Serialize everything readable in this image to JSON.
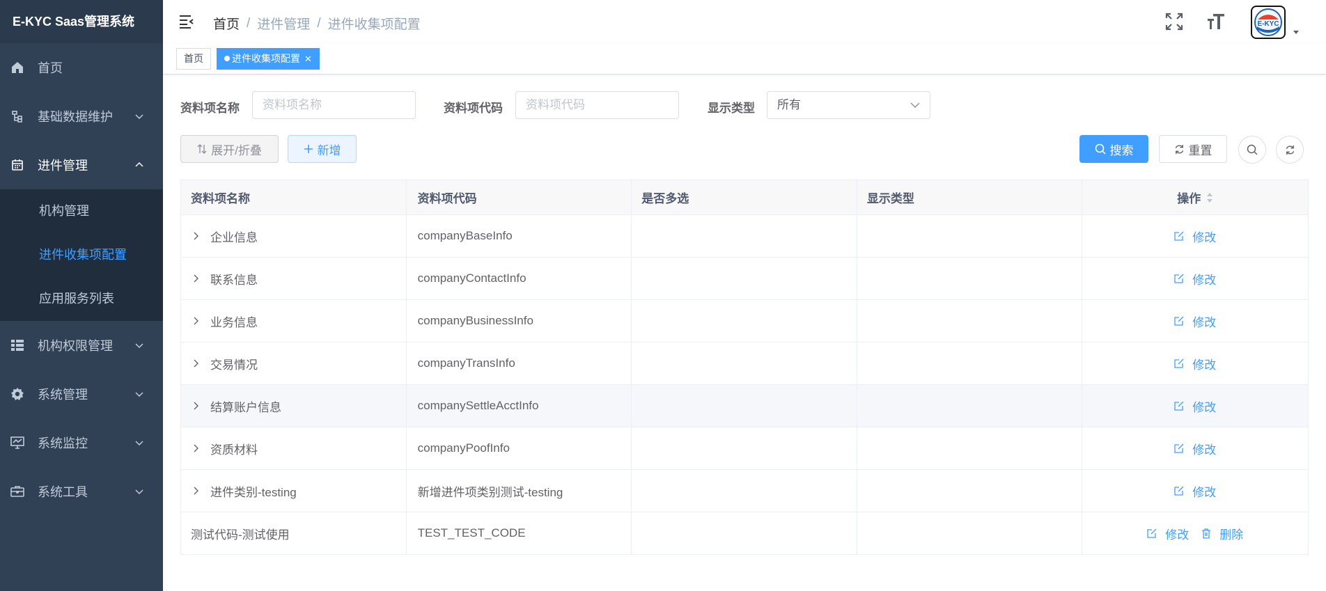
{
  "app": {
    "title": "E-KYC Saas管理系统"
  },
  "sidebar": {
    "items": [
      {
        "label": "首页",
        "icon": "home-icon"
      },
      {
        "label": "基础数据维护",
        "icon": "tree-icon"
      },
      {
        "label": "进件管理",
        "icon": "calendar-icon",
        "children": [
          {
            "label": "机构管理"
          },
          {
            "label": "进件收集项配置",
            "active": true
          },
          {
            "label": "应用服务列表"
          }
        ]
      },
      {
        "label": "机构权限管理",
        "icon": "list-icon"
      },
      {
        "label": "系统管理",
        "icon": "gear-icon"
      },
      {
        "label": "系统监控",
        "icon": "monitor-icon"
      },
      {
        "label": "系统工具",
        "icon": "toolbox-icon"
      }
    ]
  },
  "header": {
    "breadcrumb": [
      "首页",
      "进件管理",
      "进件收集项配置"
    ],
    "avatar_text": "E-KYC"
  },
  "tags": {
    "home": "首页",
    "current": "进件收集项配置"
  },
  "search": {
    "name_label": "资料项名称",
    "name_placeholder": "资料项名称",
    "code_label": "资料项代码",
    "code_placeholder": "资料项代码",
    "type_label": "显示类型",
    "type_value": "所有"
  },
  "toolbar": {
    "toggle_label": "展开/折叠",
    "add_label": "新增",
    "search_label": "搜索",
    "reset_label": "重置"
  },
  "table": {
    "columns": [
      "资料项名称",
      "资料项代码",
      "是否多选",
      "显示类型",
      "操作"
    ],
    "rows": [
      {
        "name": "企业信息",
        "code": "companyBaseInfo",
        "multi": "",
        "type": "",
        "ops": [
          "修改"
        ],
        "expandable": true
      },
      {
        "name": "联系信息",
        "code": "companyContactInfo",
        "multi": "",
        "type": "",
        "ops": [
          "修改"
        ],
        "expandable": true
      },
      {
        "name": "业务信息",
        "code": "companyBusinessInfo",
        "multi": "",
        "type": "",
        "ops": [
          "修改"
        ],
        "expandable": true
      },
      {
        "name": "交易情况",
        "code": "companyTransInfo",
        "multi": "",
        "type": "",
        "ops": [
          "修改"
        ],
        "expandable": true
      },
      {
        "name": "结算账户信息",
        "code": "companySettleAcctInfo",
        "multi": "",
        "type": "",
        "ops": [
          "修改"
        ],
        "expandable": true
      },
      {
        "name": "资质材料",
        "code": "companyPoofInfo",
        "multi": "",
        "type": "",
        "ops": [
          "修改"
        ],
        "expandable": true
      },
      {
        "name": "进件类别-testing",
        "code": "新增进件项类别测试-testing",
        "multi": "",
        "type": "",
        "ops": [
          "修改"
        ],
        "expandable": true
      },
      {
        "name": "测试代码-测试使用",
        "code": "TEST_TEST_CODE",
        "multi": "",
        "type": "",
        "ops": [
          "修改",
          "删除"
        ],
        "expandable": false
      }
    ]
  },
  "colors": {
    "primary": "#409eff",
    "sidebar_bg": "#304156",
    "submenu_bg": "#1f2d3d"
  }
}
